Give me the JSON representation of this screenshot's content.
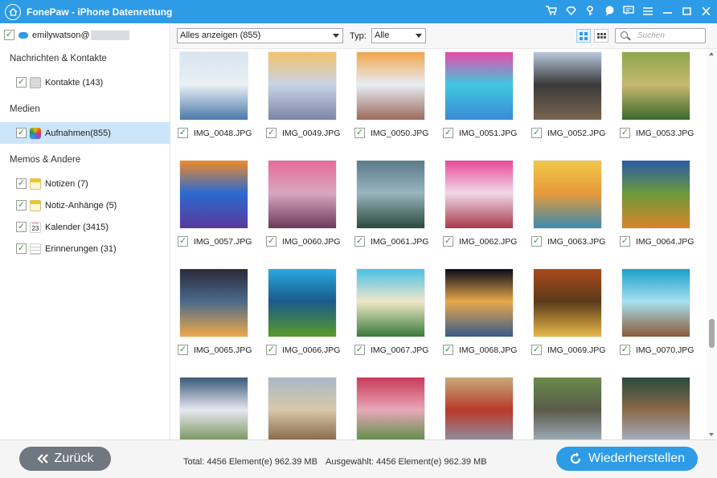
{
  "window": {
    "title": "FonePaw - iPhone Datenrettung",
    "controls": [
      "cart-icon",
      "diamond-icon",
      "key-icon",
      "chat-icon",
      "feedback-icon",
      "menu-icon",
      "minimize-icon",
      "maximize-icon",
      "close-icon"
    ]
  },
  "sidebar": {
    "account": "emilywatson@",
    "categories": [
      {
        "label": "Nachrichten & Kontakte",
        "items": [
          {
            "label": "Kontakte (143)",
            "icon": "contacts-icon"
          }
        ]
      },
      {
        "label": "Medien",
        "items": [
          {
            "label": "Aufnahmen(855)",
            "icon": "photos-icon",
            "selected": true
          }
        ]
      },
      {
        "label": "Memos & Andere",
        "items": [
          {
            "label": "Notizen (7)",
            "icon": "notes-icon"
          },
          {
            "label": "Notiz-Anhänge (5)",
            "icon": "note-attachments-icon"
          },
          {
            "label": "Kalender (3415)",
            "icon": "calendar-icon",
            "calendar_day": "23",
            "calendar_weekday": "Friday"
          },
          {
            "label": "Erinnerungen (31)",
            "icon": "reminders-icon"
          }
        ]
      }
    ]
  },
  "toolbar": {
    "filter": "Alles anzeigen (855)",
    "type_label": "Typ:",
    "type_value": "Alle",
    "search_placeholder": "Suchen"
  },
  "photos": [
    {
      "name": "IMG_0048.JPG",
      "colors": [
        "#d8e4f0",
        "#4a79a8",
        "#eaf0f5"
      ]
    },
    {
      "name": "IMG_0049.JPG",
      "colors": [
        "#f2c46a",
        "#7b86a8",
        "#c9d3e6"
      ]
    },
    {
      "name": "IMG_0050.JPG",
      "colors": [
        "#f2a54a",
        "#9a6a5a",
        "#e8edf5"
      ]
    },
    {
      "name": "IMG_0051.JPG",
      "colors": [
        "#e84aa8",
        "#3a8ad4",
        "#40c8e0"
      ]
    },
    {
      "name": "IMG_0052.JPG",
      "colors": [
        "#b8c8dc",
        "#7a6450",
        "#3a3a3a"
      ]
    },
    {
      "name": "IMG_0053.JPG",
      "colors": [
        "#8aa84a",
        "#3a6a2a",
        "#c8b870"
      ]
    },
    {
      "name": "IMG_0057.JPG",
      "colors": [
        "#f08a2a",
        "#5a3a9a",
        "#2a6ad0"
      ]
    },
    {
      "name": "IMG_0060.JPG",
      "colors": [
        "#e86a9a",
        "#6a3a5a",
        "#d8a8c0"
      ]
    },
    {
      "name": "IMG_0061.JPG",
      "colors": [
        "#5a7a8a",
        "#2a4a3a",
        "#9ab4c0"
      ]
    },
    {
      "name": "IMG_0062.JPG",
      "colors": [
        "#e84a9a",
        "#a83a4a",
        "#f0d8e8"
      ]
    },
    {
      "name": "IMG_0063.JPG",
      "colors": [
        "#f0c84a",
        "#3a8ab0",
        "#e89a3a"
      ]
    },
    {
      "name": "IMG_0064.JPG",
      "colors": [
        "#2a5aa8",
        "#d8842a",
        "#6a9a3a"
      ]
    },
    {
      "name": "IMG_0065.JPG",
      "colors": [
        "#2a2a3a",
        "#f0a84a",
        "#4a6a8a"
      ]
    },
    {
      "name": "IMG_0066.JPG",
      "colors": [
        "#2aa8e0",
        "#5a9a2a",
        "#1a5a8a"
      ]
    },
    {
      "name": "IMG_0067.JPG",
      "colors": [
        "#4ac0e8",
        "#3a7a3a",
        "#f0e8c8"
      ]
    },
    {
      "name": "IMG_0068.JPG",
      "colors": [
        "#0a0a1a",
        "#3a5a8a",
        "#e8a84a"
      ]
    },
    {
      "name": "IMG_0069.JPG",
      "colors": [
        "#a84a1a",
        "#e8b84a",
        "#5a3a1a"
      ]
    },
    {
      "name": "IMG_0070.JPG",
      "colors": [
        "#1aa0c8",
        "#8a5a3a",
        "#a8e0f0"
      ]
    },
    {
      "name": "",
      "colors": [
        "#3a5a7a",
        "#6a8a4a",
        "#e8e8f0"
      ]
    },
    {
      "name": "",
      "colors": [
        "#a8b8c8",
        "#7a5a3a",
        "#d8c8a8"
      ]
    },
    {
      "name": "",
      "colors": [
        "#c83a5a",
        "#4a8a3a",
        "#e8a8b8"
      ]
    },
    {
      "name": "",
      "colors": [
        "#c8a87a",
        "#8a9ab0",
        "#b83a2a"
      ]
    },
    {
      "name": "",
      "colors": [
        "#6a8a4a",
        "#a8b8c8",
        "#5a5a4a"
      ]
    },
    {
      "name": "",
      "colors": [
        "#2a4a3a",
        "#a8b8d0",
        "#8a6a4a"
      ]
    }
  ],
  "footer": {
    "back_label": "Zurück",
    "total_text": "Total: 4456 Element(e) 962.39 MB",
    "selected_text": "Ausgewählt: 4456 Element(e) 962.39 MB",
    "recover_label": "Wiederherstellen"
  },
  "colors": {
    "accent": "#2e9be6",
    "selected_row": "#cce5f8",
    "back_button": "#6f7780"
  }
}
